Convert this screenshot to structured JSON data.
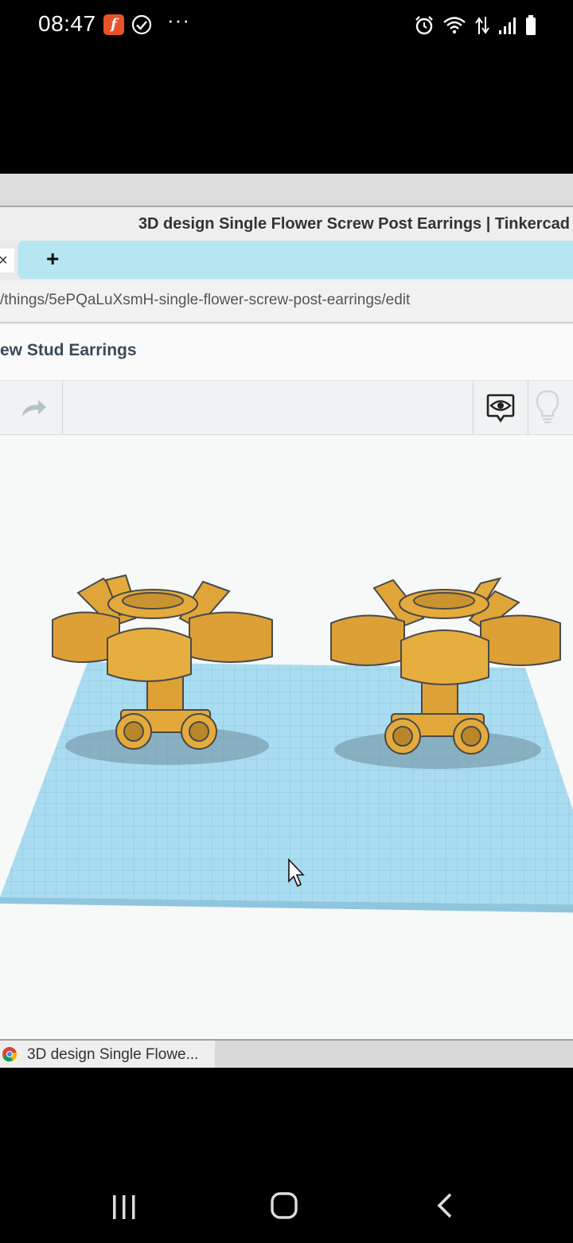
{
  "status_bar": {
    "time": "08:47",
    "flash_glyph": "f",
    "overflow": "···"
  },
  "browser": {
    "window_title": "3D design Single Flower Screw Post Earrings | Tinkercad",
    "tab_close": "×",
    "new_tab": "+",
    "url": "/things/5ePQaLuXsmH-single-flower-screw-post-earrings/edit"
  },
  "page": {
    "design_title": "ew Stud Earrings"
  },
  "taskbar": {
    "item_label": "3D design Single Flowe..."
  },
  "colors": {
    "workplane": "#a9dcf0",
    "model": "#e4a93a",
    "accent_tab": "#b7e6f3"
  }
}
